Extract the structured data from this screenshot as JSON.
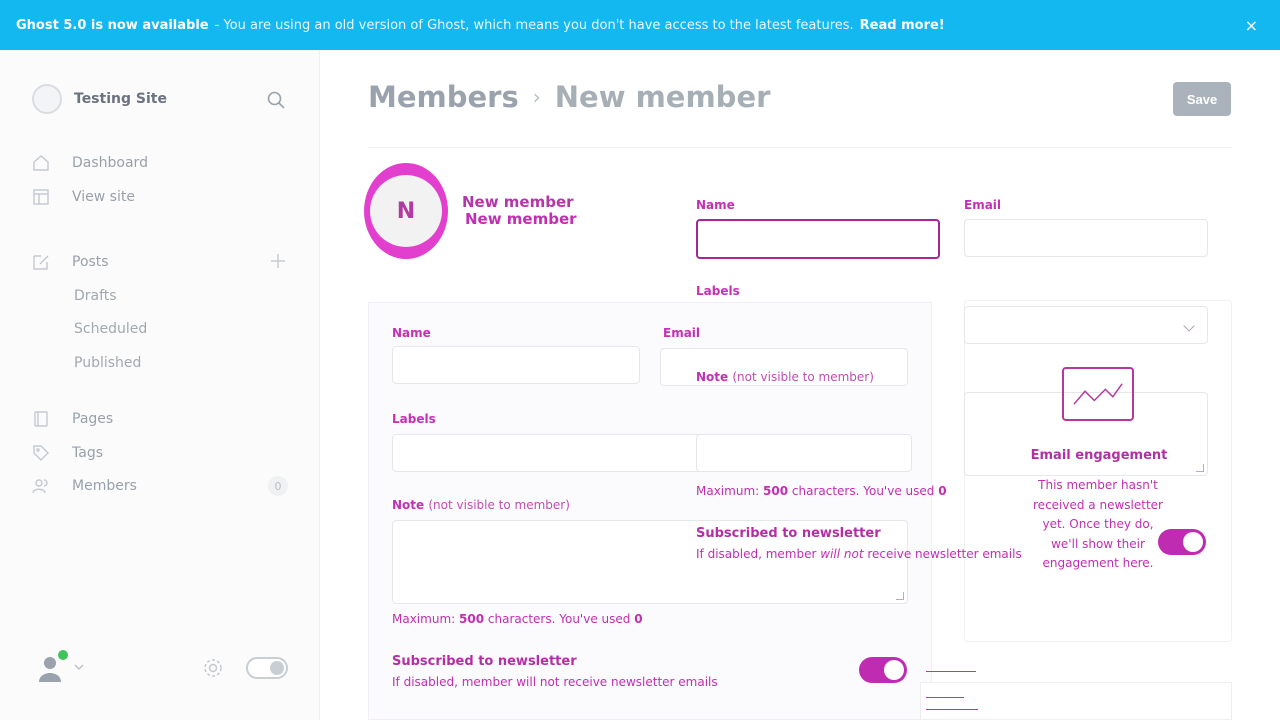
{
  "banner": {
    "title": "Ghost 5.0 is now available",
    "message": "- You are using an old version of Ghost, which means you don't have access to the latest features.",
    "link": "Read more!",
    "close": "×"
  },
  "sidebar": {
    "site_name": "Testing Site",
    "nav": [
      {
        "label": "Dashboard",
        "icon": "home-icon"
      },
      {
        "label": "View site",
        "icon": "view-site-icon"
      },
      {
        "label": "Posts",
        "icon": "posts-icon"
      },
      {
        "label": "Drafts"
      },
      {
        "label": "Scheduled"
      },
      {
        "label": "Published"
      },
      {
        "label": "Pages",
        "icon": "pages-icon"
      },
      {
        "label": "Tags",
        "icon": "tag-icon"
      },
      {
        "label": "Members",
        "icon": "members-icon",
        "count": "0"
      }
    ]
  },
  "header": {
    "breadcrumb_parent": "Members",
    "breadcrumb_separator": "›",
    "breadcrumb_current": "New member",
    "save_label": "Save"
  },
  "member": {
    "initials": "N",
    "title": "New member",
    "title_duplicate": "New member"
  },
  "form": {
    "name_label": "Name",
    "email_label": "Email",
    "labels_label": "Labels",
    "note_label": "Note",
    "note_hint": "(not visible to member)",
    "note_help_prefix": "Maximum:",
    "note_max": "500",
    "note_help_middle": "characters. You've used",
    "note_used": "0",
    "subscribed_title": "Subscribed to newsletter",
    "subscribed_desc_prefix": "If disabled, member",
    "subscribed_desc_em": "will not",
    "subscribed_desc_suffix": "receive newsletter emails",
    "ghost_help_prefix": "Maximum:",
    "ghost_help_suffix": "characters. You've used",
    "ghost_subscribed_desc": "If disabled, member will not receive newsletter emails"
  },
  "engagement": {
    "title": "Email engagement",
    "description": "This member hasn't received a newsletter yet. Once they do, we'll show their engagement here."
  },
  "colors": {
    "banner": "#14b8f0",
    "accent": "#c02cb1",
    "save_button": "#aab3bc"
  }
}
